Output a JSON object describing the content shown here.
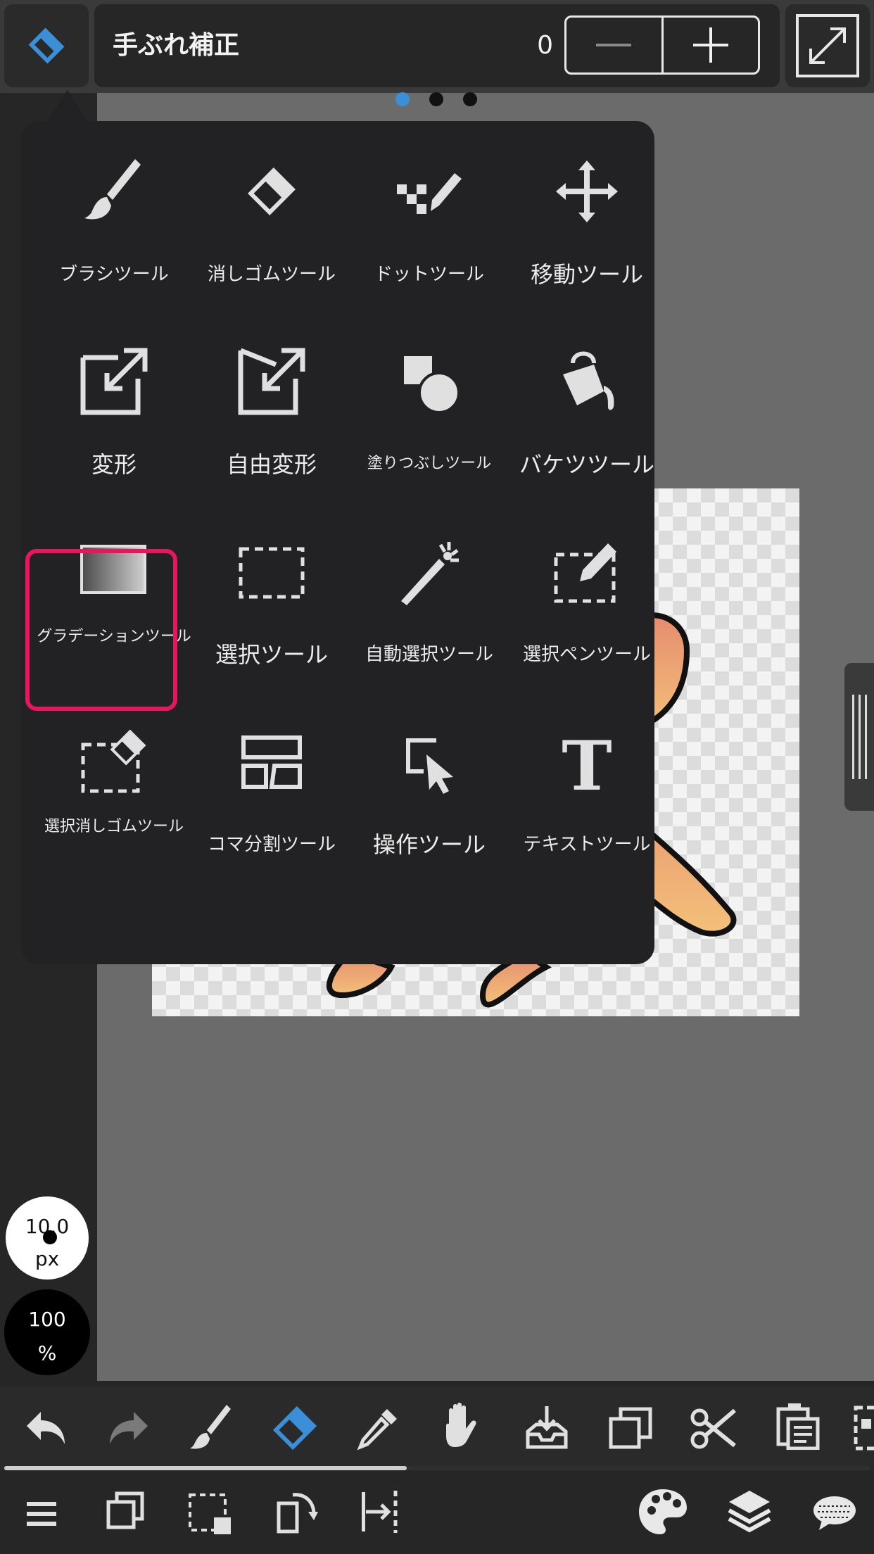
{
  "top_bar": {
    "stabilizer_label": "手ぶれ補正",
    "stabilizer_value": "0",
    "minus_icon": "minus-icon",
    "plus_icon": "plus-icon",
    "current_tool_icon": "eraser-icon",
    "fullscreen_icon": "expand-icon"
  },
  "page_dots": {
    "count": 3,
    "active_index": 0
  },
  "tool_menu": {
    "tools": [
      {
        "label": "ブラシツール",
        "icon": "brush-icon"
      },
      {
        "label": "消しゴムツール",
        "icon": "eraser-icon"
      },
      {
        "label": "ドットツール",
        "icon": "dot-pen-icon"
      },
      {
        "label": "移動ツール",
        "icon": "move-icon"
      },
      {
        "label": "変形",
        "icon": "transform-icon"
      },
      {
        "label": "自由変形",
        "icon": "free-transform-icon"
      },
      {
        "label": "塗りつぶしツール",
        "icon": "fill-shapes-icon"
      },
      {
        "label": "バケツツール",
        "icon": "bucket-icon"
      },
      {
        "label": "グラデーションツール",
        "icon": "gradient-icon",
        "selected": true
      },
      {
        "label": "選択ツール",
        "icon": "select-rect-icon"
      },
      {
        "label": "自動選択ツール",
        "icon": "magic-wand-icon"
      },
      {
        "label": "選択ペンツール",
        "icon": "select-pen-icon"
      },
      {
        "label": "選択消しゴムツール",
        "icon": "select-eraser-icon"
      },
      {
        "label": "コマ分割ツール",
        "icon": "panel-divide-icon"
      },
      {
        "label": "操作ツール",
        "icon": "operation-icon"
      },
      {
        "label": "テキストツール",
        "icon": "text-icon"
      }
    ]
  },
  "brush": {
    "size_value": "10.0",
    "size_unit": "px",
    "opacity_value": "100",
    "opacity_unit": "%"
  },
  "toolbar_primary": [
    "undo-icon",
    "redo-icon",
    "brush-icon",
    "eraser-icon",
    "eyedropper-icon",
    "hand-icon",
    "import-icon",
    "duplicate-icon",
    "scissors-icon",
    "paste-icon",
    "more-icon"
  ],
  "toolbar_secondary": [
    "menu-icon",
    "layer-copy-icon",
    "selection-icon",
    "rotate-icon",
    "flip-icon",
    "palette-icon",
    "layers-icon",
    "comment-icon"
  ],
  "colors": {
    "accent": "#3a8fd8",
    "highlight": "#e8175d",
    "menu_bg": "#222224"
  }
}
